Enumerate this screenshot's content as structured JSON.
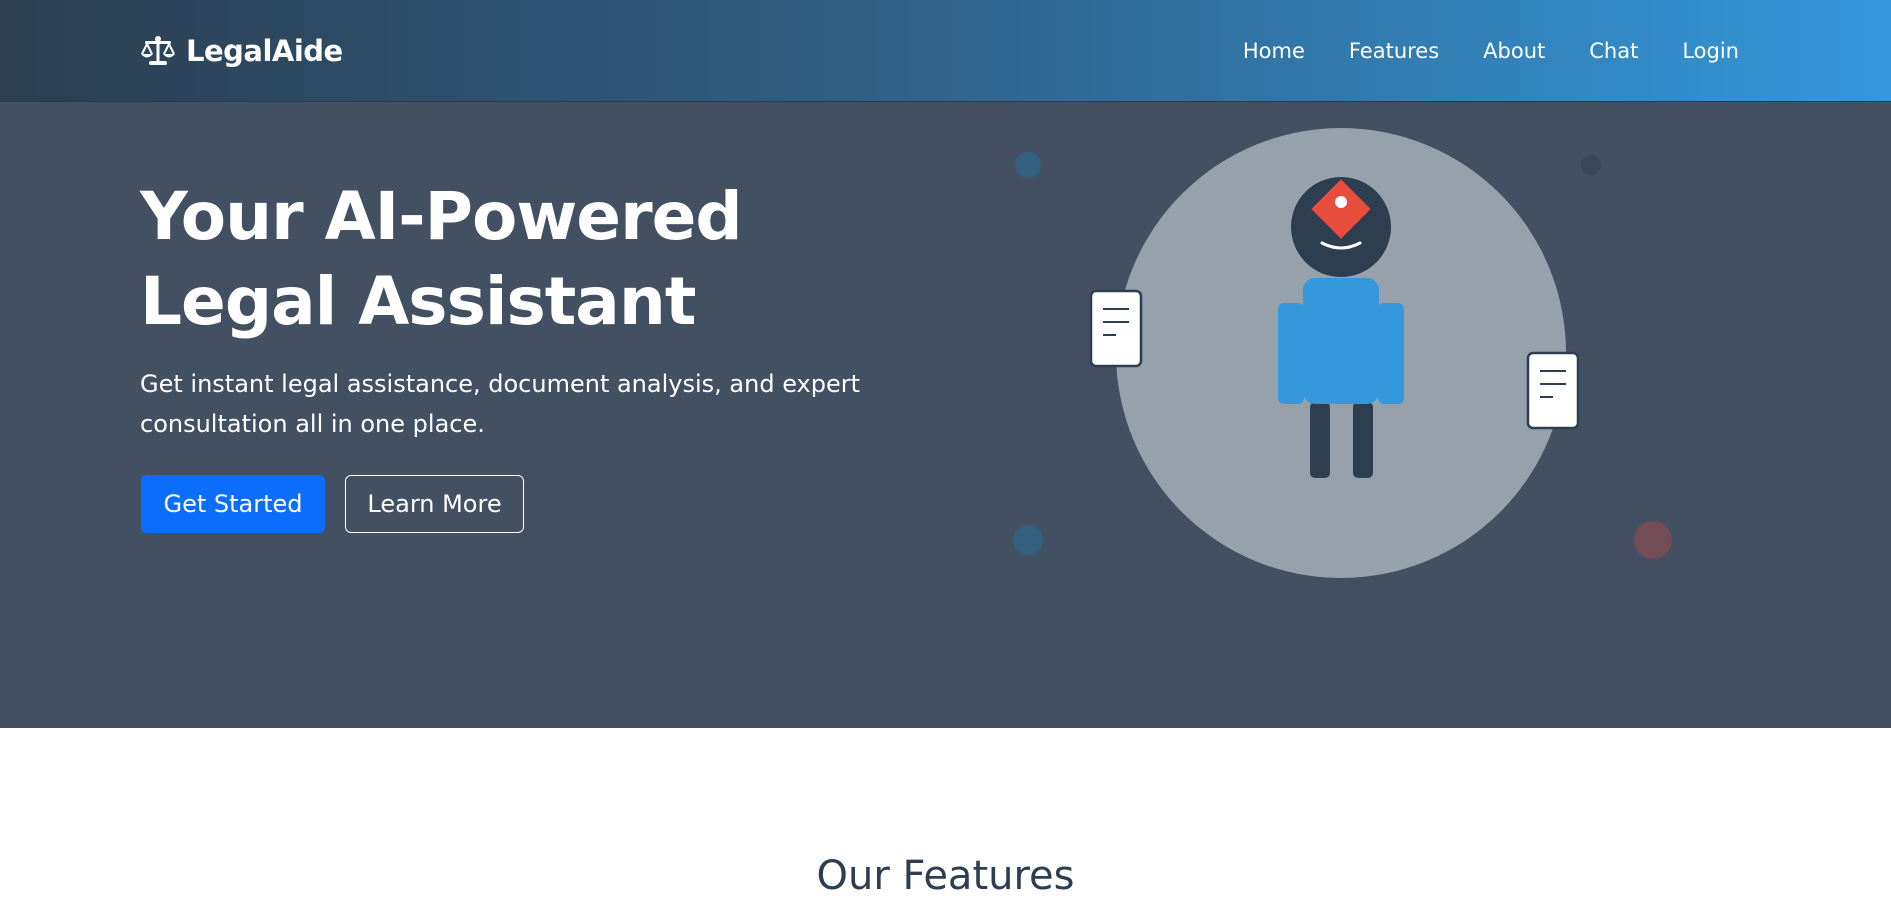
{
  "navbar": {
    "brand": "LegalAide",
    "brand_icon": "scale-balance-icon",
    "links": [
      {
        "label": "Home"
      },
      {
        "label": "Features"
      },
      {
        "label": "About"
      },
      {
        "label": "Chat"
      },
      {
        "label": "Login"
      }
    ]
  },
  "hero": {
    "title_line1": "Your AI-Powered",
    "title_line2": "Legal Assistant",
    "subtitle": "Get instant legal assistance, document analysis, and expert consultation all in one place.",
    "primary_button": "Get Started",
    "secondary_button": "Learn More",
    "illustration": "ai-legal-robot-illustration"
  },
  "features": {
    "title": "Our Features"
  },
  "colors": {
    "nav_gradient_start": "#2c3e50",
    "nav_gradient_end": "#3498db",
    "hero_background": "#435061",
    "primary": "#0d6efd",
    "accent_red": "#e74c3c",
    "accent_blue": "#3498db",
    "heading_dark": "#2c3e50"
  }
}
